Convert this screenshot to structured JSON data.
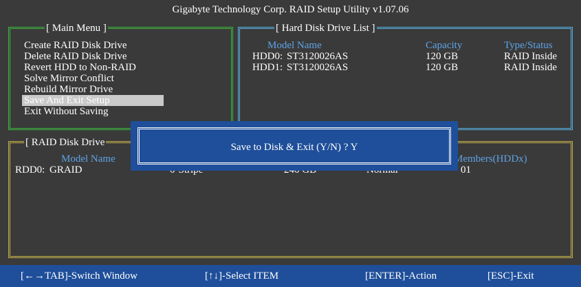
{
  "title": "Gigabyte Technology Corp.  RAID Setup Utility  v1.07.06",
  "main_menu": {
    "title": "[ Main Menu ]",
    "items": [
      "Create RAID Disk Drive",
      "Delete RAID Disk Drive",
      "Revert HDD to Non-RAID",
      "Solve Mirror Conflict",
      "Rebuild Mirror Drive",
      "Save And Exit Setup",
      "Exit Without Saving"
    ]
  },
  "hdd_list": {
    "title": "[ Hard Disk Drive List ]",
    "headers": [
      "Model Name",
      "Capacity",
      "Type/Status"
    ],
    "rows": [
      {
        "id": "HDD0:",
        "model": "ST3120026AS",
        "capacity": "120 GB",
        "status": "RAID Inside"
      },
      {
        "id": "HDD1:",
        "model": "ST3120026AS",
        "capacity": "120 GB",
        "status": "RAID Inside"
      }
    ]
  },
  "raid_list": {
    "title": "[ RAID Disk Drive",
    "headers": [
      "Model Name",
      "Members(HDDx)"
    ],
    "rows": [
      {
        "id": "RDD0:",
        "model": "GRAID",
        "level": "0-Stripe",
        "capacity": "240 GB",
        "status": "Normal",
        "members": "01"
      }
    ]
  },
  "dialog": {
    "text": "Save to Disk & Exit (Y/N) ? Y"
  },
  "footer": [
    "[←→TAB]-Switch Window",
    "[↑↓]-Select ITEM",
    "[ENTER]-Action",
    "[ESC]-Exit"
  ]
}
